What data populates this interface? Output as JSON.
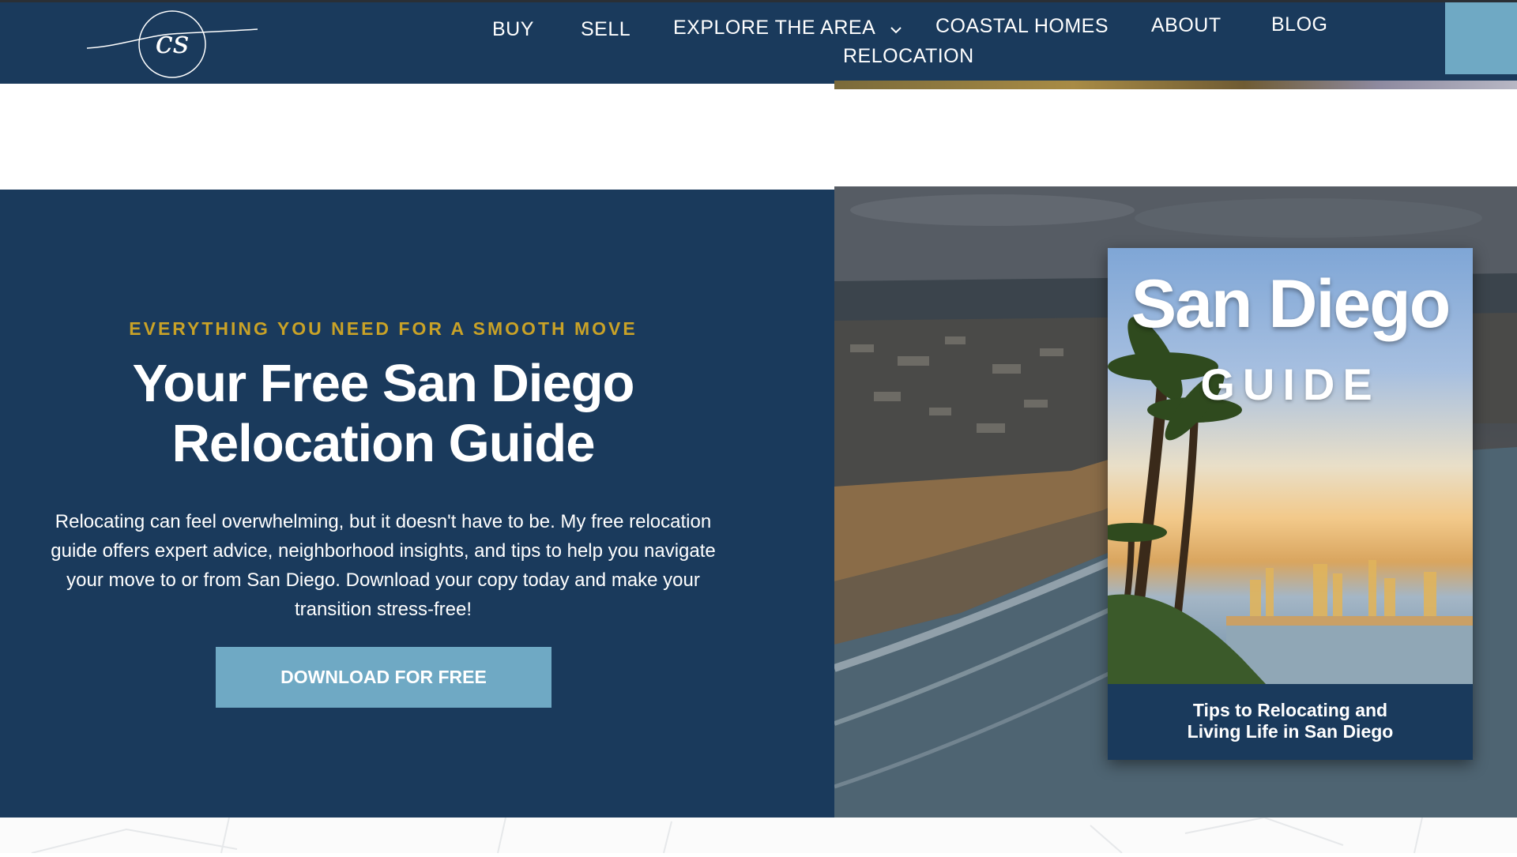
{
  "nav": {
    "items": [
      {
        "label": "BUY"
      },
      {
        "label": "SELL"
      },
      {
        "label": "EXPLORE THE AREA"
      },
      {
        "label": "COASTAL HOMES"
      },
      {
        "label": "ABOUT"
      },
      {
        "label": "BLOG"
      },
      {
        "label": "RELOCATION"
      }
    ],
    "logo_text": "cs"
  },
  "hero": {
    "eyebrow": "EVERYTHING YOU NEED FOR A SMOOTH MOVE",
    "title_line1": "Your Free San Diego",
    "title_line2": "Relocation Guide",
    "body": "Relocating can feel overwhelming, but it doesn't have to be. My free relocation guide offers expert advice, neighborhood insights, and tips to help you navigate your move to or from San Diego. Download your copy today and make your transition stress-free!",
    "cta_label": "DOWNLOAD FOR FREE"
  },
  "guide": {
    "title": "San Diego",
    "subtitle": "GUIDE",
    "footer_line1": "Tips to Relocating and",
    "footer_line2": "Living Life in San Diego"
  },
  "colors": {
    "navy": "#1a3a5c",
    "accent_blue": "#6fa9c4",
    "gold": "#c9a227"
  }
}
